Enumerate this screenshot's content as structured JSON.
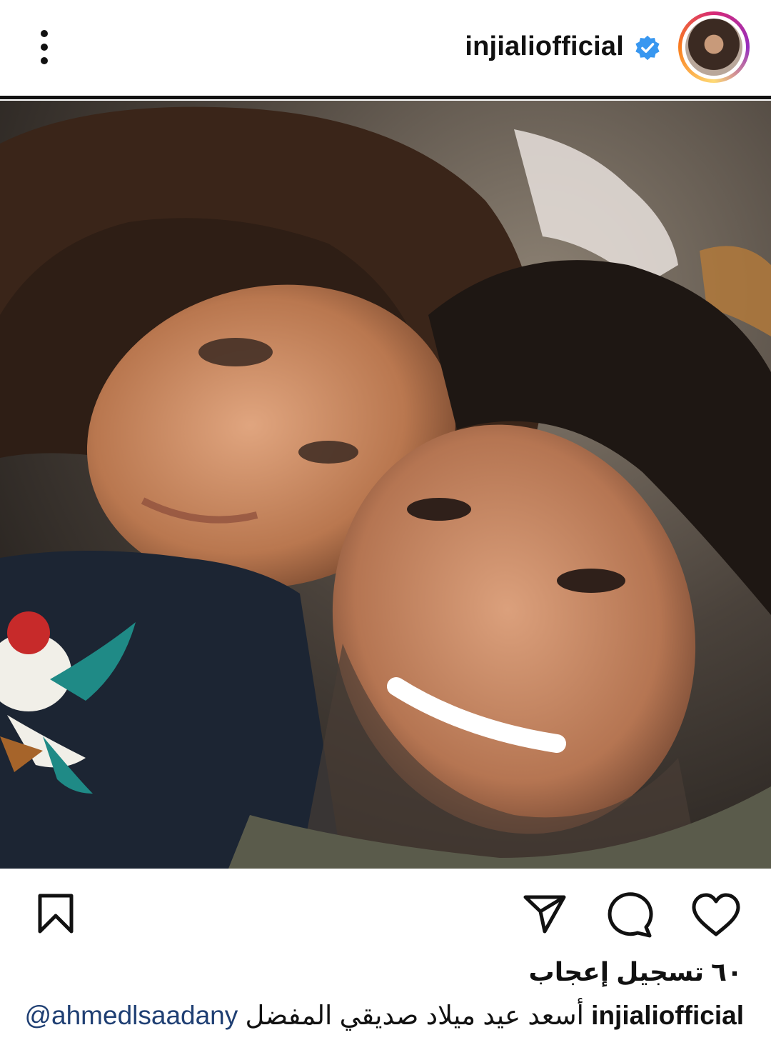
{
  "post": {
    "username": "injialiofficial",
    "likes_text": "٦٠ تسجيل إعجاب",
    "caption_username": "injialiofficial",
    "caption_text": "أسعد عيد ميلاد صديقي المفضل",
    "caption_mention": "@ahmedlsaadany"
  },
  "icons": {
    "more": "more-vertical-icon",
    "verified": "verified-badge-icon",
    "tag": "user-tag-icon",
    "bookmark": "bookmark-icon",
    "share": "send-icon",
    "comment": "comment-icon",
    "like": "heart-icon"
  },
  "colors": {
    "verified": "#3897f0",
    "mention": "#1f3f73",
    "story_ring": [
      "#d62976",
      "#962fbf",
      "#feda75",
      "#fa7e1e"
    ]
  }
}
